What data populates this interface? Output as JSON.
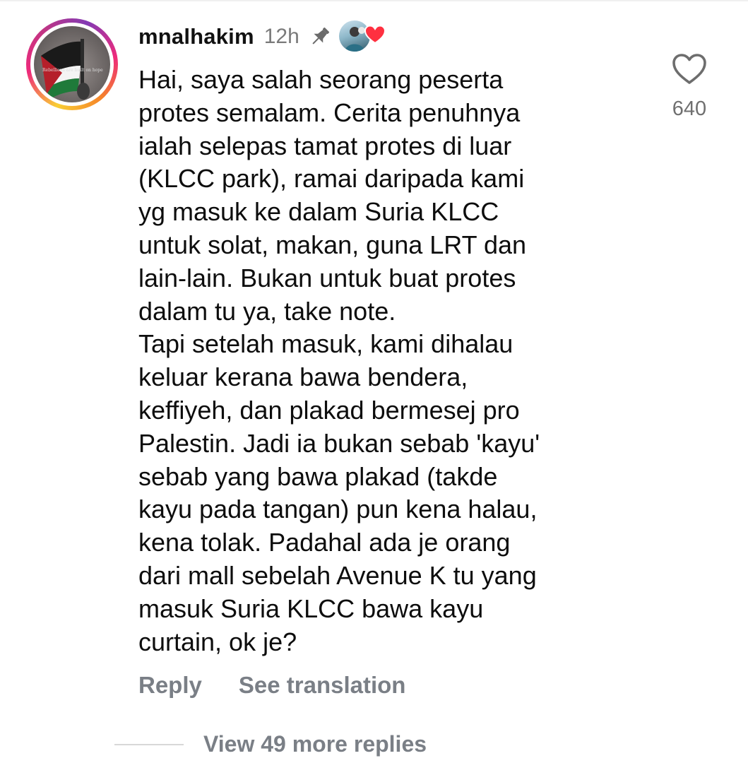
{
  "comment": {
    "username": "mnalhakim",
    "time": "12h",
    "avatar_caption": "Rebellions are built on hope",
    "text": "Hai, saya salah seorang peserta\nprotes semalam. Cerita penuhnya\nialah selepas tamat protes di luar\n(KLCC park), ramai daripada kami\nyg masuk ke dalam Suria KLCC\nuntuk solat, makan, guna LRT dan\nlain-lain. Bukan untuk buat protes\ndalam tu ya, take note.\nTapi setelah masuk, kami dihalau\nkeluar kerana bawa bendera,\nkeffiyeh, dan plakad bermesej pro\nPalestin. Jadi ia bukan sebab 'kayu'\nsebab yang bawa plakad (takde\nkayu pada tangan) pun kena halau,\nkena tolak. Padahal ada je orang\ndari mall sebelah Avenue K tu yang\nmasuk Suria KLCC bawa kayu\ncurtain, ok je?",
    "like_count": "640",
    "icons": {
      "pin": "pin-icon",
      "liked_by": "creator-liked-avatar",
      "heart_badge": "heart-icon",
      "like": "heart-outline-icon"
    }
  },
  "actions": {
    "reply_label": "Reply",
    "translate_label": "See translation"
  },
  "replies": {
    "view_more_label": "View 49 more replies"
  },
  "colors": {
    "heart_red": "#ff3040",
    "muted_text": "#7a7f86",
    "ring_start": "#f9ce34",
    "ring_mid": "#ee2a7b",
    "ring_end": "#833ab4"
  }
}
